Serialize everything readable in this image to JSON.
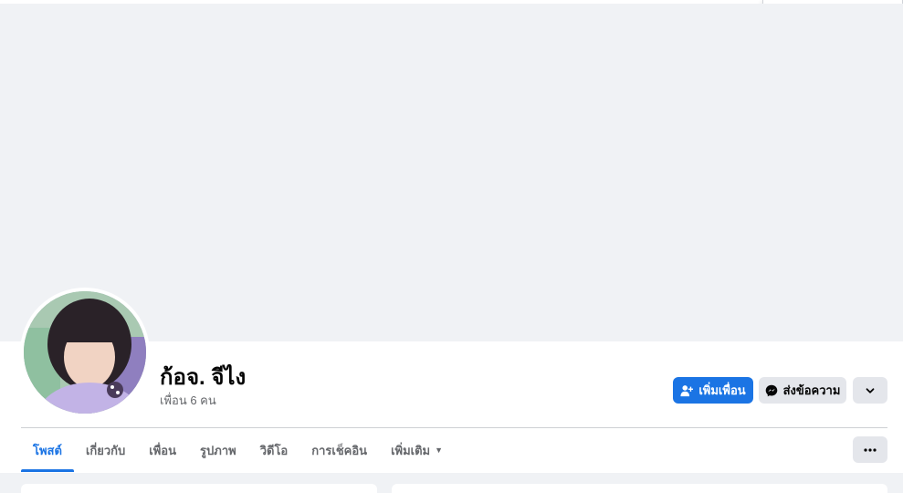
{
  "profile": {
    "name": "ก้อจ. จีไง",
    "friends_count": "เพื่อน 6 คน"
  },
  "actions": {
    "add_friend_label": "เพิ่มเพื่อน",
    "message_label": "ส่งข้อความ"
  },
  "tabs": [
    {
      "label": "โพสต์",
      "active": true
    },
    {
      "label": "เกี่ยวกับ",
      "active": false
    },
    {
      "label": "เพื่อน",
      "active": false
    },
    {
      "label": "รูปภาพ",
      "active": false
    },
    {
      "label": "วิดีโอ",
      "active": false
    },
    {
      "label": "การเช็คอิน",
      "active": false
    },
    {
      "label": "เพิ่มเติม",
      "active": false
    }
  ],
  "icons": {
    "add_friend": "person-add-icon",
    "message": "messenger-icon",
    "more_arrow": "chevron-down-icon",
    "overflow": "more-dots-icon",
    "tab_more": "caret-down-icon"
  },
  "colors": {
    "accent": "#1b74e4",
    "page_background": "#f0f2f5",
    "secondary_button": "#e4e6eb",
    "muted_text": "#65676b",
    "primary_text": "#050505"
  }
}
